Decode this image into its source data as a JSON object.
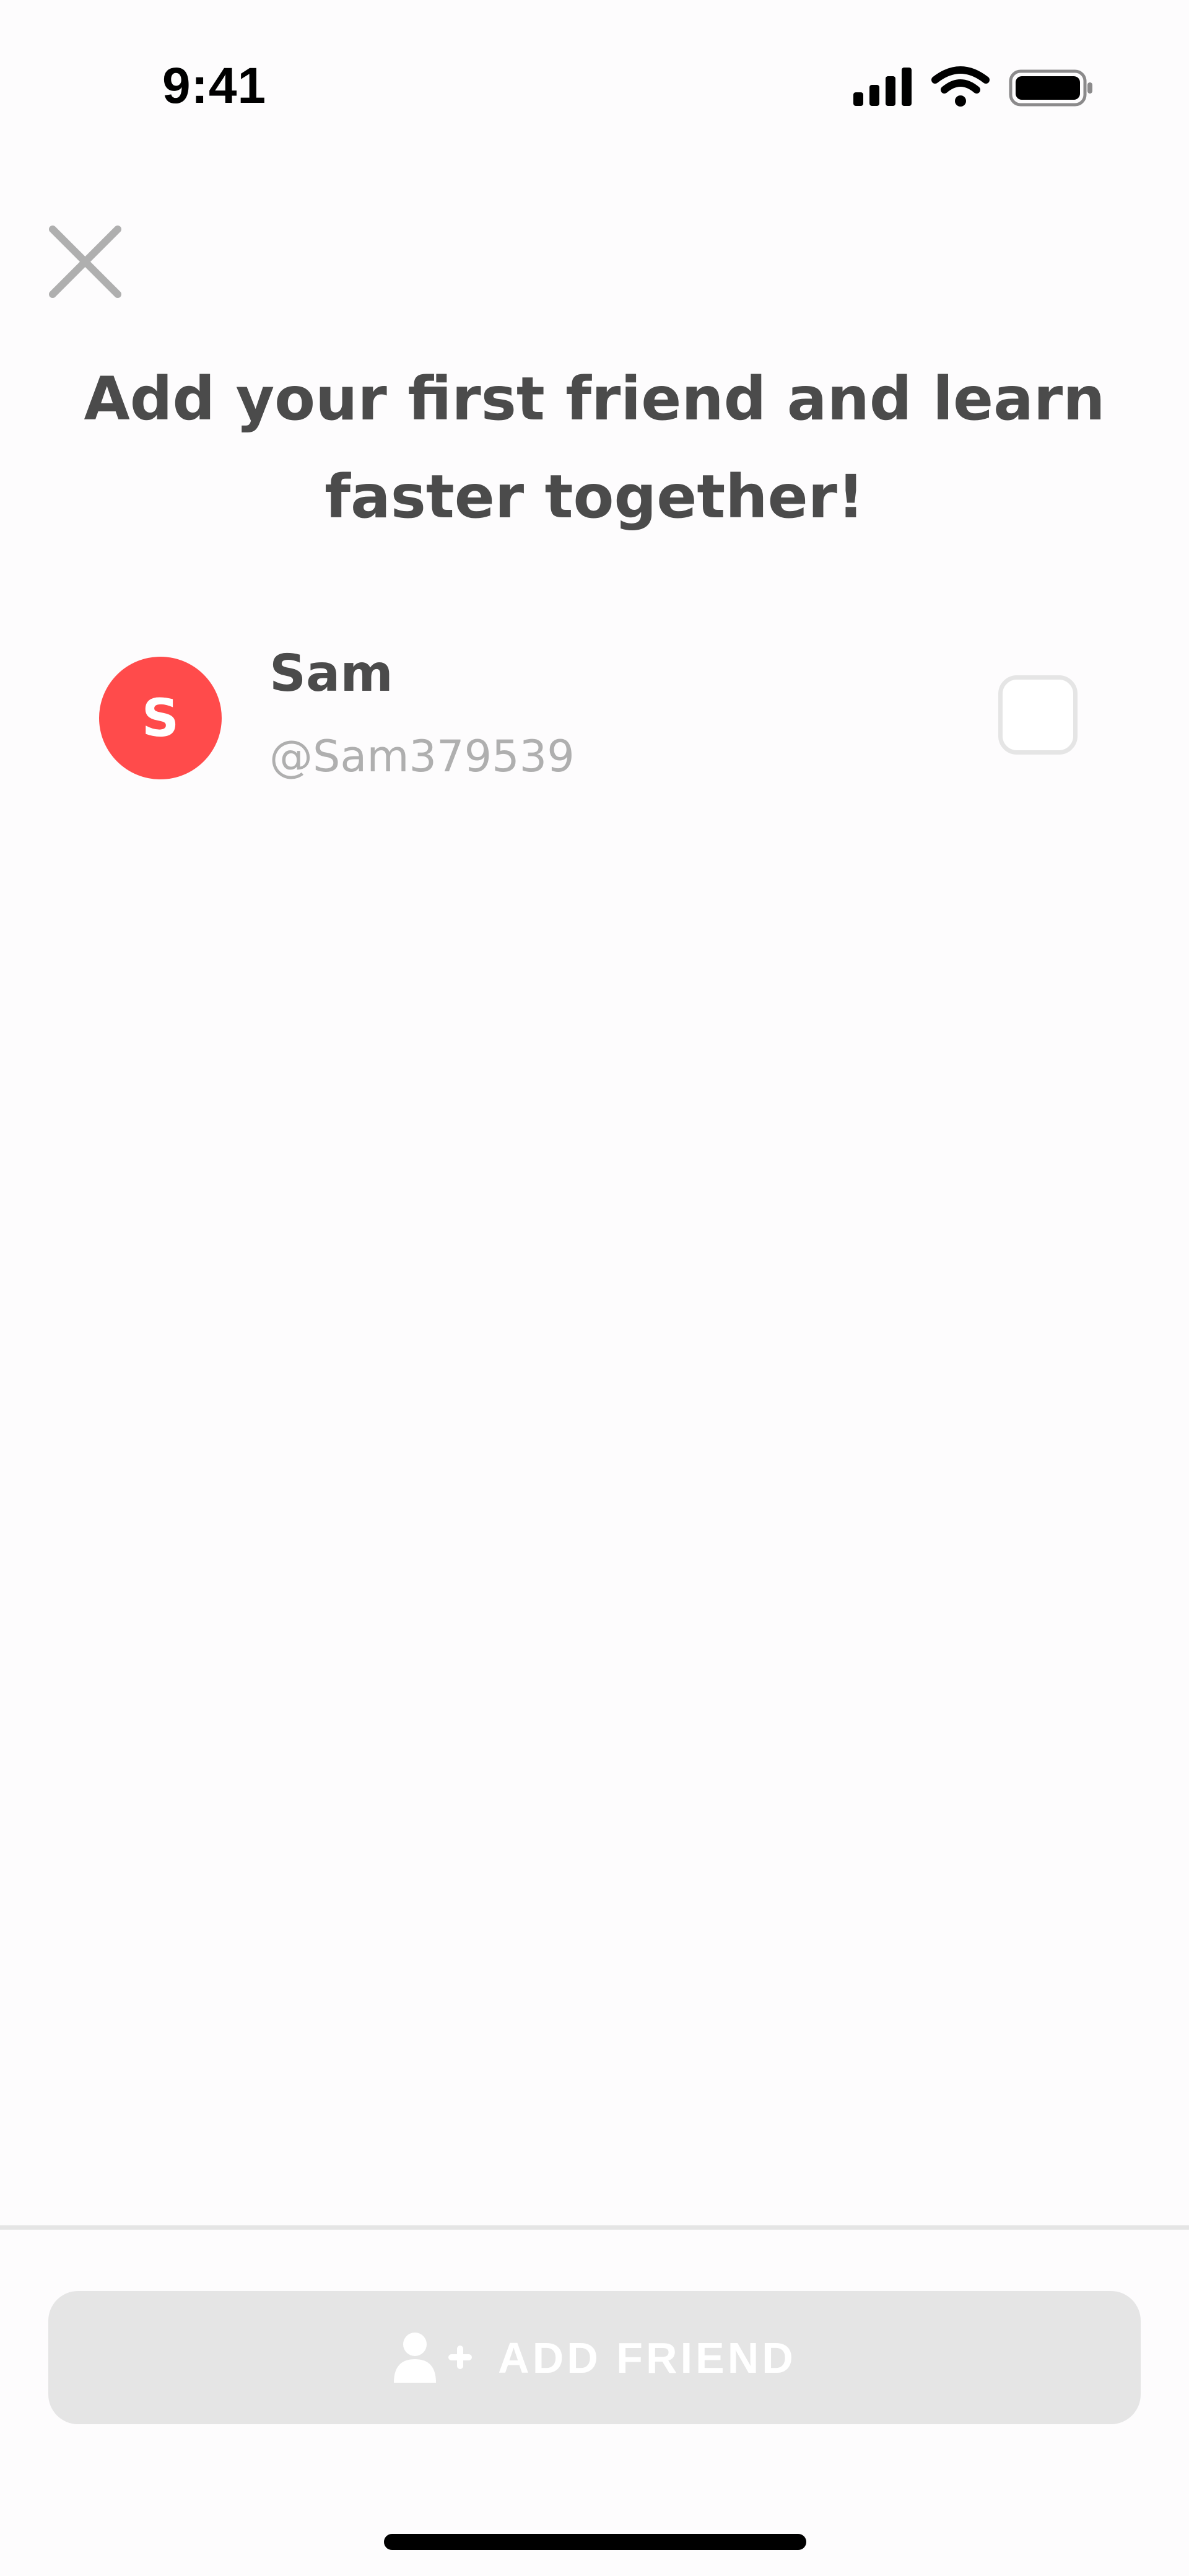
{
  "status_bar": {
    "time": "9:41",
    "icons": [
      "cellular-signal-icon",
      "wifi-icon",
      "battery-icon"
    ]
  },
  "header": {
    "close_icon": "close-icon",
    "headline": "Add your first friend and learn faster together!"
  },
  "friends": [
    {
      "avatar_letter": "S",
      "avatar_color": "#ff4b4b",
      "name": "Sam",
      "handle": "@Sam379539",
      "selected": false
    }
  ],
  "footer": {
    "button_icon": "add-person-icon",
    "button_label": "ADD FRIEND",
    "button_enabled": false
  },
  "colors": {
    "text_primary": "#4b4b4b",
    "text_secondary": "#afafaf",
    "disabled": "#e5e5e5",
    "accent_red": "#ff4b4b"
  }
}
